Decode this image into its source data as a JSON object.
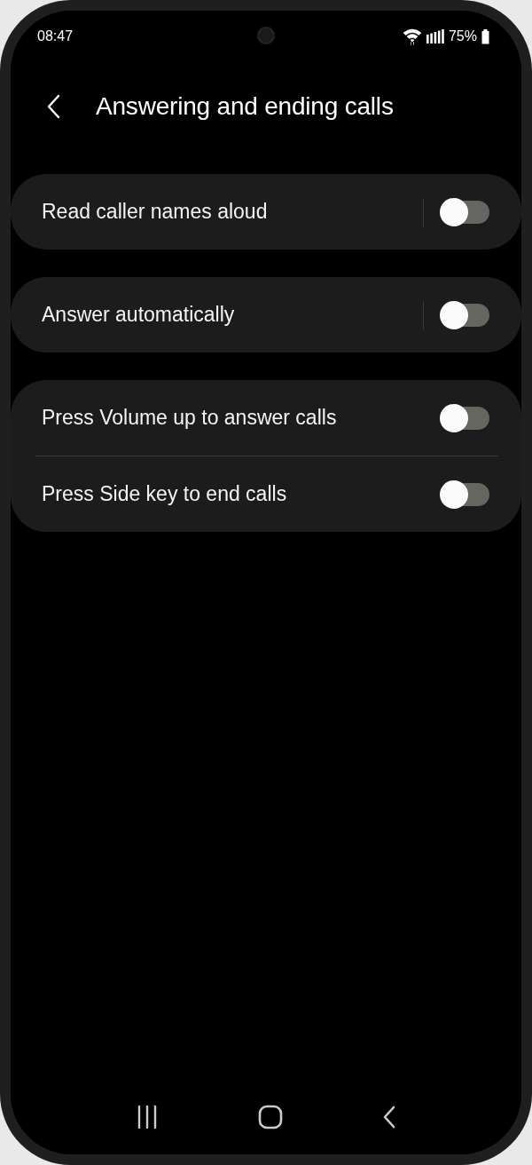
{
  "status_bar": {
    "time": "08:47",
    "battery": "75%"
  },
  "header": {
    "title": "Answering and ending calls"
  },
  "groups": [
    {
      "items": [
        {
          "label": "Read caller names aloud",
          "divider": true,
          "on": false
        }
      ]
    },
    {
      "items": [
        {
          "label": "Answer automatically",
          "divider": true,
          "on": false
        }
      ]
    },
    {
      "items": [
        {
          "label": "Press Volume up to answer calls",
          "divider": false,
          "on": false
        },
        {
          "label": "Press Side key to end calls",
          "divider": false,
          "on": false
        }
      ]
    }
  ]
}
